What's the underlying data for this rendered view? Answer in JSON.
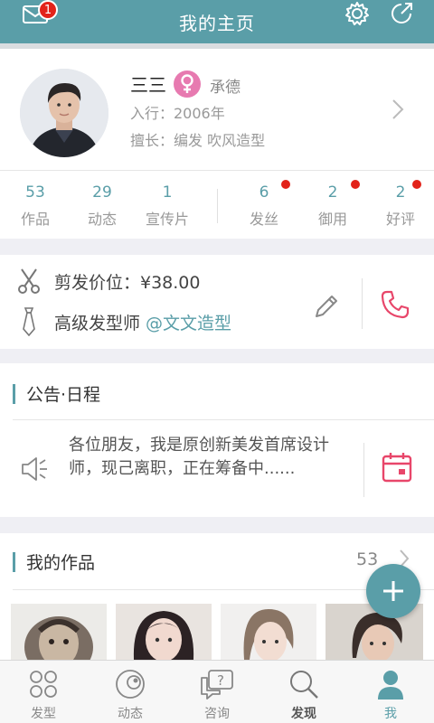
{
  "header": {
    "title": "我的主页",
    "mail_badge": "1",
    "accent": "#5a9ea8"
  },
  "profile": {
    "name": "三三",
    "city": "承德",
    "since": "入行：2006年",
    "skill": "擅长：编发 吹风造型",
    "gender_icon": "female-icon"
  },
  "stats": [
    {
      "num": "53",
      "label": "作品"
    },
    {
      "num": "29",
      "label": "动态"
    },
    {
      "num": "1",
      "label": "宣传片"
    },
    {
      "num": "6",
      "label": "发丝"
    },
    {
      "num": "2",
      "label": "御用"
    },
    {
      "num": "2",
      "label": "好评"
    }
  ],
  "price": {
    "label": "剪发价位：¥38.00",
    "title": "高级发型师",
    "salon": "@文文造型"
  },
  "notice": {
    "section_title": "公告·日程",
    "text": "各位朋友，我是原创新美发首席设计师，现己离职，正在筹备中......"
  },
  "works": {
    "section_title": "我的作品",
    "count": "53"
  },
  "tabs": [
    {
      "label": "发型",
      "icon": "grid-icon"
    },
    {
      "label": "动态",
      "icon": "moments-icon"
    },
    {
      "label": "咨询",
      "icon": "question-icon"
    },
    {
      "label": "发现",
      "icon": "search-icon"
    },
    {
      "label": "我",
      "icon": "person-icon"
    }
  ]
}
